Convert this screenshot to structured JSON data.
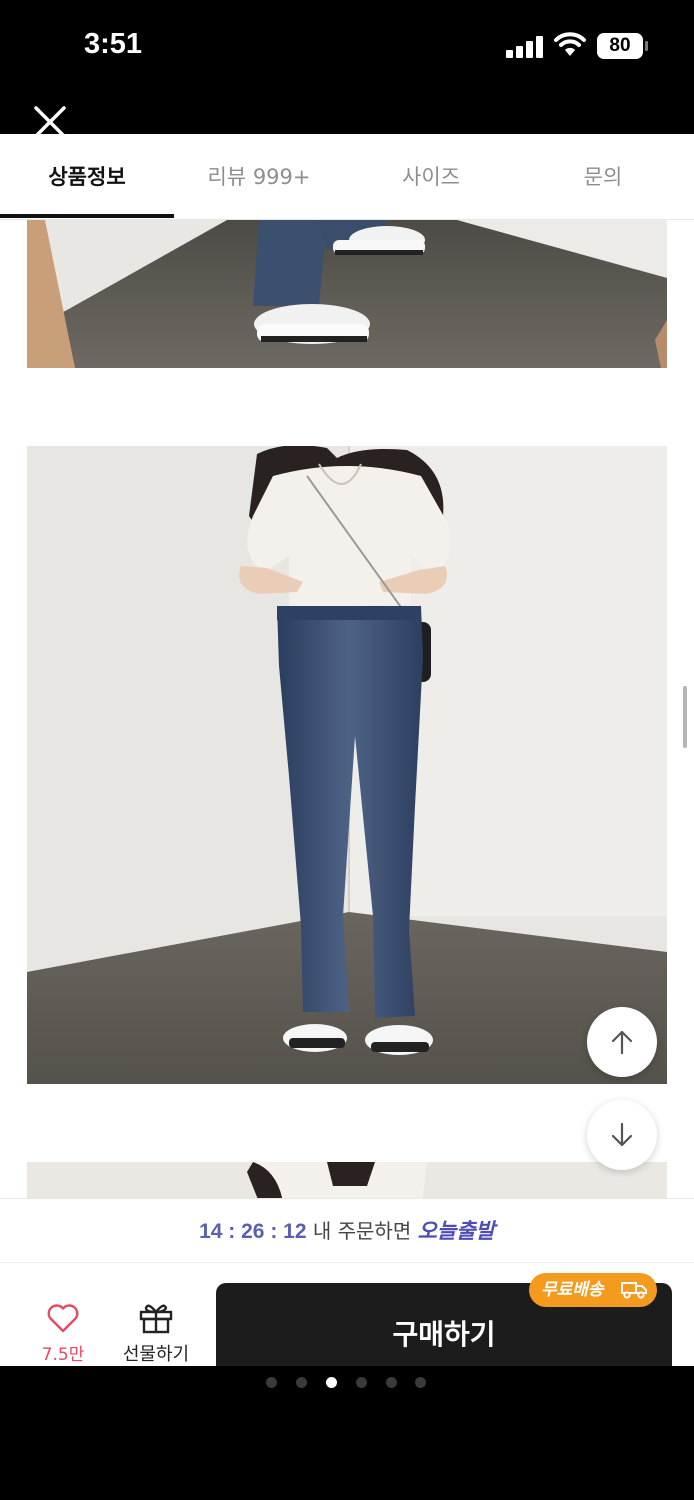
{
  "status_bar": {
    "time": "3:51",
    "battery": "80"
  },
  "tabs": [
    {
      "label": "상품정보",
      "active": true
    },
    {
      "label": "리뷰 999+",
      "active": false
    },
    {
      "label": "사이즈",
      "active": false
    },
    {
      "label": "문의",
      "active": false
    }
  ],
  "promo": {
    "timer": "14 : 26 : 12",
    "text": "내 주문하면",
    "highlight": "오늘출발"
  },
  "actions": {
    "like_count": "7.5만",
    "gift_label": "선물하기",
    "buy_label": "구매하기",
    "free_shipping_badge": "무료배송"
  },
  "pager": {
    "total": 6,
    "current": 3
  },
  "colors": {
    "accent_orange": "#f39a1f",
    "like_red": "#e84a5f",
    "promo_blue": "#4d4db9",
    "buy_button": "#1c1c1c"
  }
}
